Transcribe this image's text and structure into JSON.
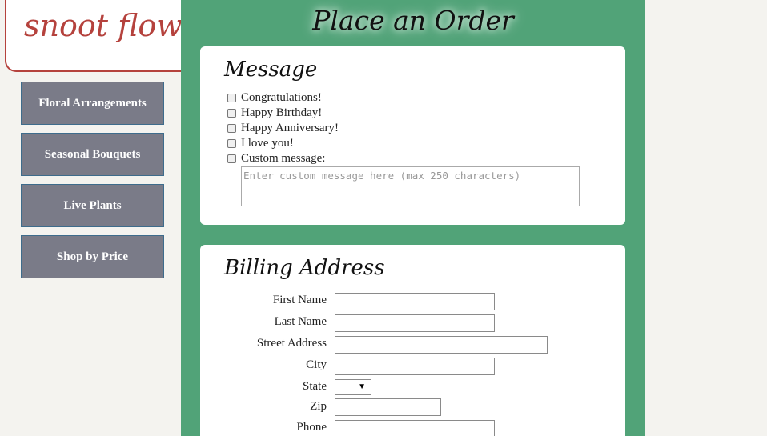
{
  "logo": {
    "text": "snoot flowers"
  },
  "sidebar": {
    "items": [
      {
        "label": "Floral Arrangements"
      },
      {
        "label": "Seasonal Bouquets"
      },
      {
        "label": "Live Plants"
      },
      {
        "label": "Shop by Price"
      }
    ]
  },
  "main": {
    "title": "Place an Order",
    "message": {
      "title": "Message",
      "options": [
        {
          "label": "Congratulations!",
          "checked": false
        },
        {
          "label": "Happy Birthday!",
          "checked": false
        },
        {
          "label": "Happy Anniversary!",
          "checked": false
        },
        {
          "label": "I love you!",
          "checked": false
        },
        {
          "label": "Custom message:",
          "checked": false
        }
      ],
      "custom_placeholder": "Enter custom message here (max 250 characters)",
      "custom_value": ""
    },
    "billing": {
      "title": "Billing Address",
      "fields": [
        {
          "label": "First Name",
          "value": ""
        },
        {
          "label": "Last Name",
          "value": ""
        },
        {
          "label": "Street Address",
          "value": ""
        },
        {
          "label": "City",
          "value": ""
        },
        {
          "label": "State",
          "value": ""
        },
        {
          "label": "Zip",
          "value": ""
        },
        {
          "label": "Phone",
          "value": ""
        }
      ],
      "state_dropdown_glyph": "▼"
    }
  }
}
